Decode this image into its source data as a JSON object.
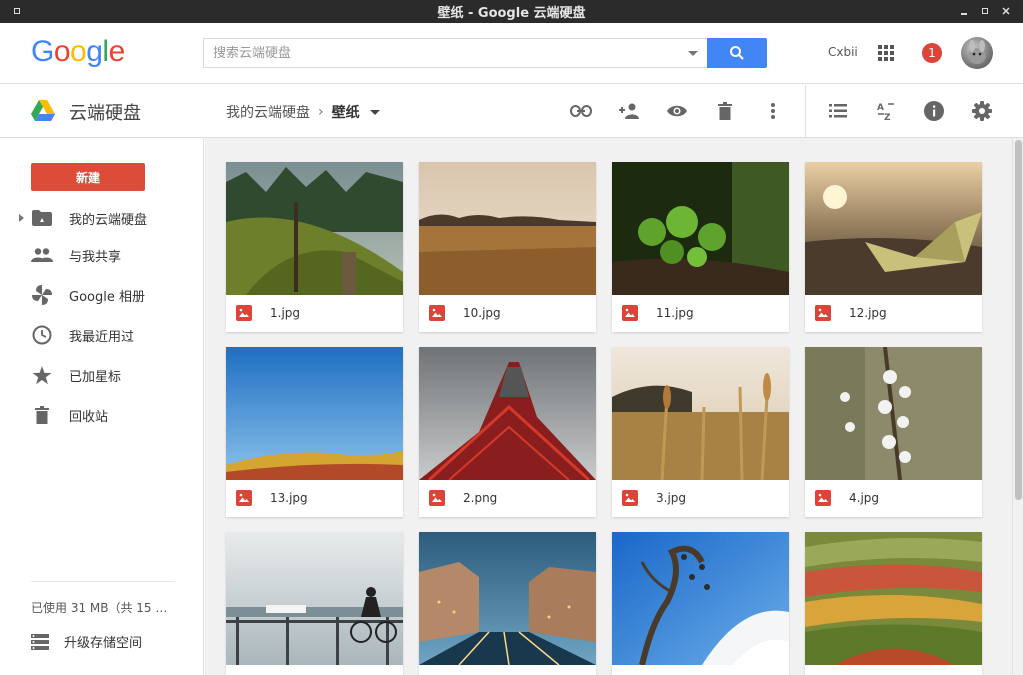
{
  "window": {
    "title": "壁纸 - Google 云端硬盘"
  },
  "header": {
    "logo": "Google",
    "search_placeholder": "搜索云端硬盘",
    "account_name": "Cxbii",
    "notification_count": "1"
  },
  "toolbar": {
    "drive_title": "云端硬盘",
    "breadcrumb_root": "我的云端硬盘",
    "breadcrumb_current": "壁纸"
  },
  "sidebar": {
    "new_label": "新建",
    "items": [
      {
        "label": "我的云端硬盘",
        "icon": "folder-drive-icon"
      },
      {
        "label": "与我共享",
        "icon": "people-icon"
      },
      {
        "label": "Google 相册",
        "icon": "photos-pinwheel-icon"
      },
      {
        "label": "我最近用过",
        "icon": "clock-icon"
      },
      {
        "label": "已加星标",
        "icon": "star-icon"
      },
      {
        "label": "回收站",
        "icon": "trash-icon"
      }
    ],
    "storage_text": "已使用 31 MB（共 15 …",
    "upgrade_label": "升级存储空间"
  },
  "files": [
    {
      "name": "1.jpg"
    },
    {
      "name": "10.jpg"
    },
    {
      "name": "11.jpg"
    },
    {
      "name": "12.jpg"
    },
    {
      "name": "13.jpg"
    },
    {
      "name": "2.png"
    },
    {
      "name": "3.jpg"
    },
    {
      "name": "4.jpg"
    },
    {
      "name": ""
    },
    {
      "name": ""
    },
    {
      "name": ""
    },
    {
      "name": ""
    }
  ],
  "colors": {
    "accent_blue": "#4285f4",
    "new_button_red": "#dd4b39",
    "notification_red": "#db4437",
    "titlebar": "#2b2b2b"
  }
}
